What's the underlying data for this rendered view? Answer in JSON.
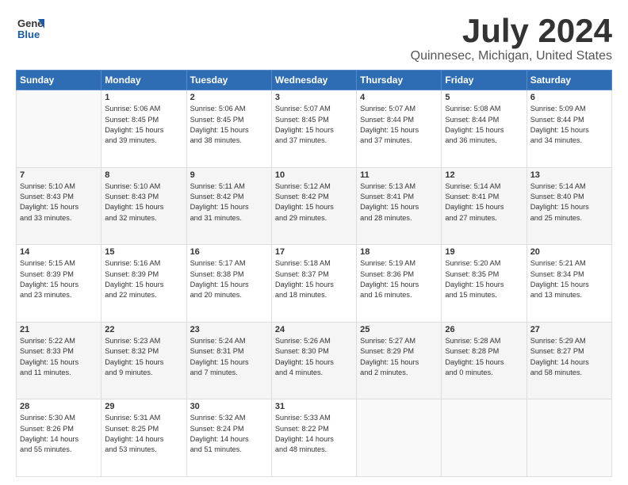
{
  "header": {
    "logo_line1": "General",
    "logo_line2": "Blue",
    "title": "July 2024",
    "subtitle": "Quinnesec, Michigan, United States"
  },
  "days_of_week": [
    "Sunday",
    "Monday",
    "Tuesday",
    "Wednesday",
    "Thursday",
    "Friday",
    "Saturday"
  ],
  "weeks": [
    [
      {
        "day": "",
        "info": ""
      },
      {
        "day": "1",
        "info": "Sunrise: 5:06 AM\nSunset: 8:45 PM\nDaylight: 15 hours\nand 39 minutes."
      },
      {
        "day": "2",
        "info": "Sunrise: 5:06 AM\nSunset: 8:45 PM\nDaylight: 15 hours\nand 38 minutes."
      },
      {
        "day": "3",
        "info": "Sunrise: 5:07 AM\nSunset: 8:45 PM\nDaylight: 15 hours\nand 37 minutes."
      },
      {
        "day": "4",
        "info": "Sunrise: 5:07 AM\nSunset: 8:44 PM\nDaylight: 15 hours\nand 37 minutes."
      },
      {
        "day": "5",
        "info": "Sunrise: 5:08 AM\nSunset: 8:44 PM\nDaylight: 15 hours\nand 36 minutes."
      },
      {
        "day": "6",
        "info": "Sunrise: 5:09 AM\nSunset: 8:44 PM\nDaylight: 15 hours\nand 34 minutes."
      }
    ],
    [
      {
        "day": "7",
        "info": "Sunrise: 5:10 AM\nSunset: 8:43 PM\nDaylight: 15 hours\nand 33 minutes."
      },
      {
        "day": "8",
        "info": "Sunrise: 5:10 AM\nSunset: 8:43 PM\nDaylight: 15 hours\nand 32 minutes."
      },
      {
        "day": "9",
        "info": "Sunrise: 5:11 AM\nSunset: 8:42 PM\nDaylight: 15 hours\nand 31 minutes."
      },
      {
        "day": "10",
        "info": "Sunrise: 5:12 AM\nSunset: 8:42 PM\nDaylight: 15 hours\nand 29 minutes."
      },
      {
        "day": "11",
        "info": "Sunrise: 5:13 AM\nSunset: 8:41 PM\nDaylight: 15 hours\nand 28 minutes."
      },
      {
        "day": "12",
        "info": "Sunrise: 5:14 AM\nSunset: 8:41 PM\nDaylight: 15 hours\nand 27 minutes."
      },
      {
        "day": "13",
        "info": "Sunrise: 5:14 AM\nSunset: 8:40 PM\nDaylight: 15 hours\nand 25 minutes."
      }
    ],
    [
      {
        "day": "14",
        "info": "Sunrise: 5:15 AM\nSunset: 8:39 PM\nDaylight: 15 hours\nand 23 minutes."
      },
      {
        "day": "15",
        "info": "Sunrise: 5:16 AM\nSunset: 8:39 PM\nDaylight: 15 hours\nand 22 minutes."
      },
      {
        "day": "16",
        "info": "Sunrise: 5:17 AM\nSunset: 8:38 PM\nDaylight: 15 hours\nand 20 minutes."
      },
      {
        "day": "17",
        "info": "Sunrise: 5:18 AM\nSunset: 8:37 PM\nDaylight: 15 hours\nand 18 minutes."
      },
      {
        "day": "18",
        "info": "Sunrise: 5:19 AM\nSunset: 8:36 PM\nDaylight: 15 hours\nand 16 minutes."
      },
      {
        "day": "19",
        "info": "Sunrise: 5:20 AM\nSunset: 8:35 PM\nDaylight: 15 hours\nand 15 minutes."
      },
      {
        "day": "20",
        "info": "Sunrise: 5:21 AM\nSunset: 8:34 PM\nDaylight: 15 hours\nand 13 minutes."
      }
    ],
    [
      {
        "day": "21",
        "info": "Sunrise: 5:22 AM\nSunset: 8:33 PM\nDaylight: 15 hours\nand 11 minutes."
      },
      {
        "day": "22",
        "info": "Sunrise: 5:23 AM\nSunset: 8:32 PM\nDaylight: 15 hours\nand 9 minutes."
      },
      {
        "day": "23",
        "info": "Sunrise: 5:24 AM\nSunset: 8:31 PM\nDaylight: 15 hours\nand 7 minutes."
      },
      {
        "day": "24",
        "info": "Sunrise: 5:26 AM\nSunset: 8:30 PM\nDaylight: 15 hours\nand 4 minutes."
      },
      {
        "day": "25",
        "info": "Sunrise: 5:27 AM\nSunset: 8:29 PM\nDaylight: 15 hours\nand 2 minutes."
      },
      {
        "day": "26",
        "info": "Sunrise: 5:28 AM\nSunset: 8:28 PM\nDaylight: 15 hours\nand 0 minutes."
      },
      {
        "day": "27",
        "info": "Sunrise: 5:29 AM\nSunset: 8:27 PM\nDaylight: 14 hours\nand 58 minutes."
      }
    ],
    [
      {
        "day": "28",
        "info": "Sunrise: 5:30 AM\nSunset: 8:26 PM\nDaylight: 14 hours\nand 55 minutes."
      },
      {
        "day": "29",
        "info": "Sunrise: 5:31 AM\nSunset: 8:25 PM\nDaylight: 14 hours\nand 53 minutes."
      },
      {
        "day": "30",
        "info": "Sunrise: 5:32 AM\nSunset: 8:24 PM\nDaylight: 14 hours\nand 51 minutes."
      },
      {
        "day": "31",
        "info": "Sunrise: 5:33 AM\nSunset: 8:22 PM\nDaylight: 14 hours\nand 48 minutes."
      },
      {
        "day": "",
        "info": ""
      },
      {
        "day": "",
        "info": ""
      },
      {
        "day": "",
        "info": ""
      }
    ]
  ]
}
